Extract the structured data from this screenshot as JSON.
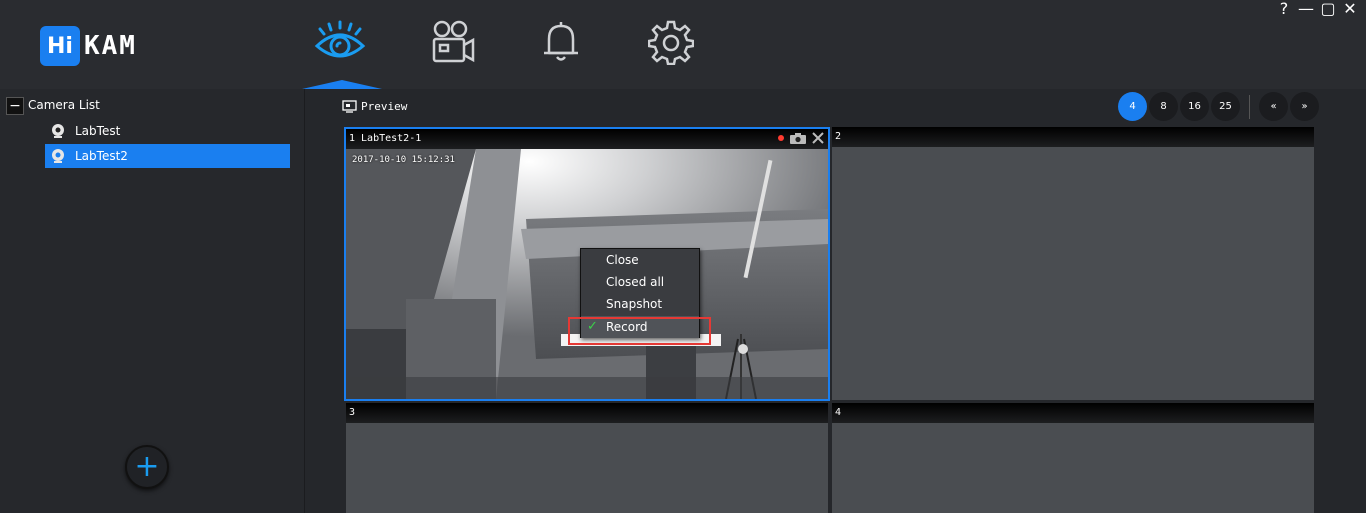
{
  "window": {
    "help_label": "?",
    "minimize_label": "—",
    "maximize_label": "▢",
    "close_label": "✕"
  },
  "logo": {
    "badge": "Hi",
    "rest": "KAM"
  },
  "nav": [
    {
      "id": "preview",
      "icon": "eye-icon",
      "active": true
    },
    {
      "id": "playback",
      "icon": "video-camera-icon",
      "active": false
    },
    {
      "id": "alarm",
      "icon": "bell-icon",
      "active": false
    },
    {
      "id": "settings",
      "icon": "gear-icon",
      "active": false
    }
  ],
  "colors": {
    "accent": "#1a7ff0",
    "record": "#ff3b30",
    "check": "#3bd14a",
    "highlight": "#e53935"
  },
  "sidebar": {
    "root_label": "Camera List",
    "toggle_label": "−",
    "cameras": [
      {
        "label": "LabTest",
        "selected": false
      },
      {
        "label": "LabTest2",
        "selected": true
      }
    ],
    "add_label": "+"
  },
  "preview": {
    "label": "Preview",
    "layouts": [
      "4",
      "8",
      "16",
      "25"
    ],
    "active_layout": "4",
    "prev_label": "«",
    "next_label": "»"
  },
  "tiles": [
    {
      "header": "1  LabTest2-1",
      "osd": "2017-10-10 15:12:31"
    },
    {
      "header": "2"
    },
    {
      "header": "3"
    },
    {
      "header": "4"
    }
  ],
  "context_menu": {
    "items": [
      {
        "label": "Close",
        "checked": false
      },
      {
        "label": "Closed all",
        "checked": false
      },
      {
        "label": "Snapshot",
        "checked": false
      },
      {
        "label": "Record",
        "checked": true
      }
    ],
    "check_glyph": "✓"
  }
}
